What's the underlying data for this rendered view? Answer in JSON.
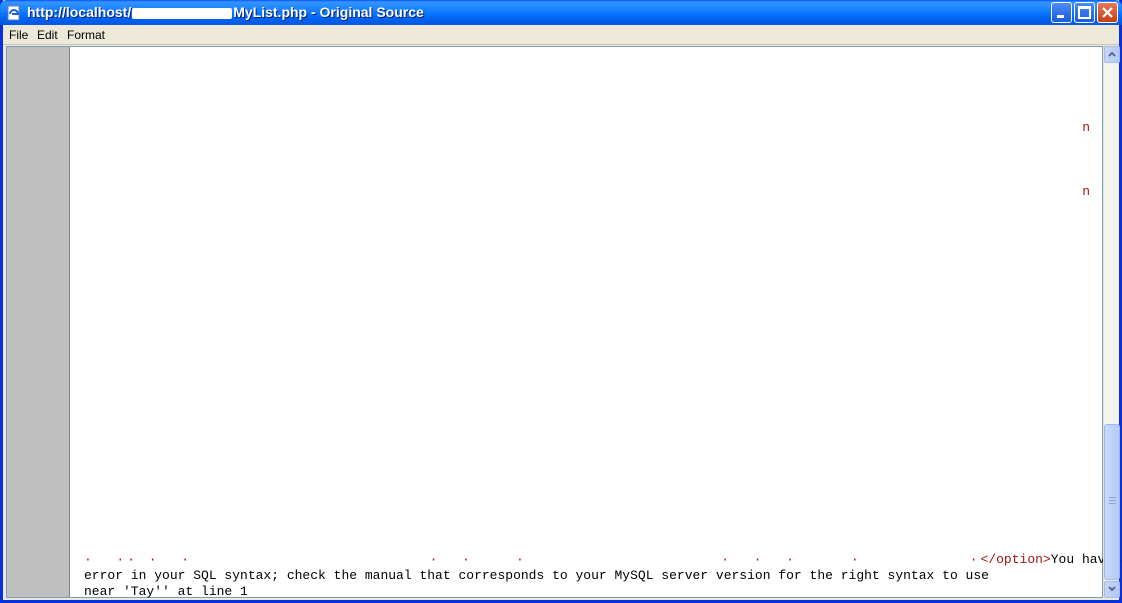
{
  "window": {
    "title_prefix": "http://localhost/",
    "title_suffix": "MyList.php - Original Source"
  },
  "menu": {
    "items": [
      "File",
      "Edit",
      "Format"
    ]
  },
  "editor": {
    "markers": [
      "n",
      "n"
    ],
    "code_lines": {
      "line1_dots": "·  ·· ·  ·                      ·  ·    ·                  ·  ·  ·     ·          ·",
      "line1_tag": "</option>",
      "line1_text": "You have an",
      "line2": "error in your SQL syntax; check the manual that corresponds to your MySQL server version for the right syntax to use",
      "line3": "near 'Tay'' at line 1"
    }
  },
  "colors": {
    "titlebar": "#0058ee",
    "gutter": "#bfbfbf",
    "tag": "#a31515"
  }
}
